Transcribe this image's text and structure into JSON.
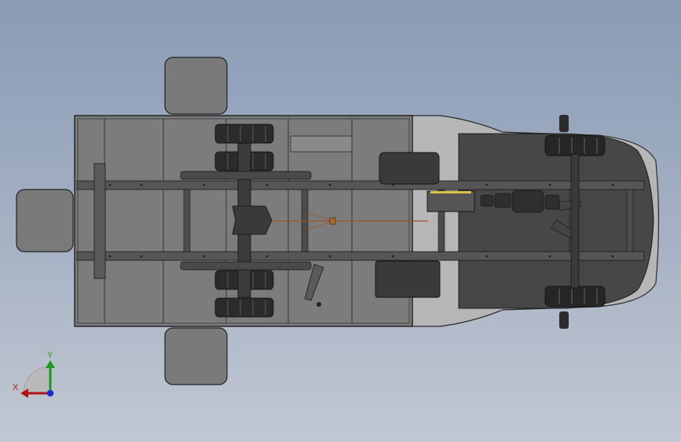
{
  "viewport": {
    "background_top": "#8a9bb5",
    "background_bottom": "#c2c8d2",
    "model_fill": "#7d7d7d",
    "model_dark": "#4a4a4a",
    "model_edge": "#1e1e1e"
  },
  "triad": {
    "x_label": "X",
    "y_label": "Y",
    "x_color": "#b01515",
    "y_color": "#1a9a1a",
    "z_color": "#1a2ad0"
  }
}
